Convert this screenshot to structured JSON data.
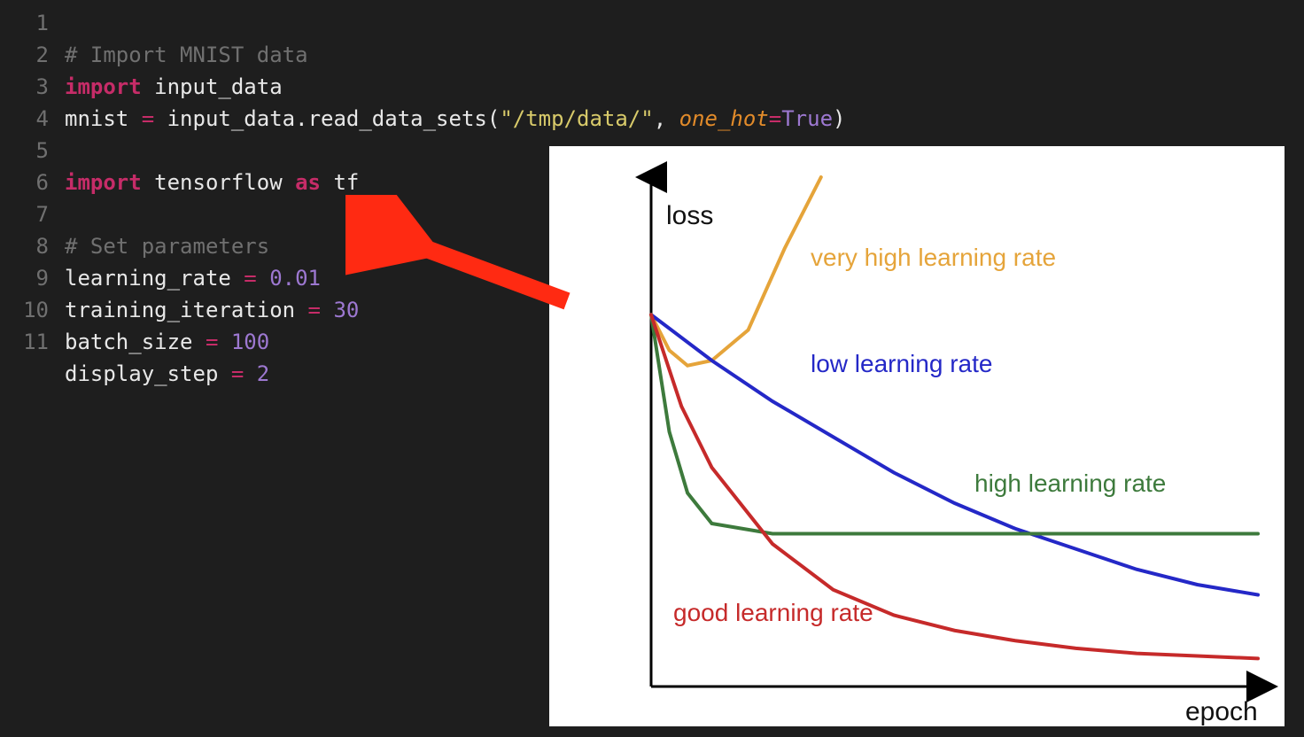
{
  "code": {
    "lines": [
      "1",
      "2",
      "3",
      "4",
      "5",
      "6",
      "7",
      "8",
      "9",
      "10",
      "11"
    ],
    "l1_comment": "# Import MNIST data",
    "l2_kw": "import",
    "l2_ident": "input_data",
    "l3_ident1": "mnist",
    "l3_op": " = ",
    "l3_ident2": "input_data",
    "l3_dot": ".",
    "l3_func": "read_data_sets",
    "l3_open": "(",
    "l3_str": "\"/tmp/data/\"",
    "l3_comma": ", ",
    "l3_param": "one_hot",
    "l3_eq": "=",
    "l3_true": "True",
    "l3_close": ")",
    "l5_kw1": "import",
    "l5_ident": "tensorflow",
    "l5_kw2": "as",
    "l5_alias": "tf",
    "l7_comment": "# Set parameters",
    "l8_ident": "learning_rate",
    "l8_op": " = ",
    "l8_num": "0.01",
    "l9_ident": "training_iteration",
    "l9_op": " = ",
    "l9_num": "30",
    "l10_ident": "batch_size",
    "l10_op": " = ",
    "l10_num": "100",
    "l11_ident": "display_step",
    "l11_op": " = ",
    "l11_num": "2"
  },
  "chart": {
    "ylabel": "loss",
    "xlabel": "epoch",
    "labels": {
      "very_high": "very high learning rate",
      "low": "low learning rate",
      "high": "high learning rate",
      "good": "good learning rate"
    },
    "colors": {
      "very_high": "#e5a43a",
      "low": "#2428c7",
      "high": "#3d7a3c",
      "good": "#c62a2a",
      "axis": "#000000"
    }
  },
  "chart_data": {
    "type": "line",
    "title": "",
    "xlabel": "epoch",
    "ylabel": "loss",
    "xlim": [
      0,
      10
    ],
    "ylim": [
      0,
      1
    ],
    "series": [
      {
        "name": "very high learning rate",
        "x": [
          0,
          0.3,
          0.6,
          1.0,
          1.6,
          2.2,
          2.8
        ],
        "y": [
          0.73,
          0.66,
          0.63,
          0.64,
          0.7,
          0.86,
          1.0
        ]
      },
      {
        "name": "low learning rate",
        "x": [
          0,
          1,
          2,
          3,
          4,
          5,
          6,
          7,
          8,
          9,
          10
        ],
        "y": [
          0.73,
          0.64,
          0.56,
          0.49,
          0.42,
          0.36,
          0.31,
          0.27,
          0.23,
          0.2,
          0.18
        ]
      },
      {
        "name": "high learning rate",
        "x": [
          0,
          0.3,
          0.6,
          1.0,
          2,
          3,
          4,
          5,
          6,
          7,
          8,
          9,
          10
        ],
        "y": [
          0.73,
          0.5,
          0.38,
          0.32,
          0.3,
          0.3,
          0.3,
          0.3,
          0.3,
          0.3,
          0.3,
          0.3,
          0.3
        ]
      },
      {
        "name": "good learning rate",
        "x": [
          0,
          0.5,
          1,
          2,
          3,
          4,
          5,
          6,
          7,
          8,
          9,
          10
        ],
        "y": [
          0.73,
          0.55,
          0.43,
          0.28,
          0.19,
          0.14,
          0.11,
          0.09,
          0.075,
          0.065,
          0.06,
          0.055
        ]
      }
    ]
  }
}
